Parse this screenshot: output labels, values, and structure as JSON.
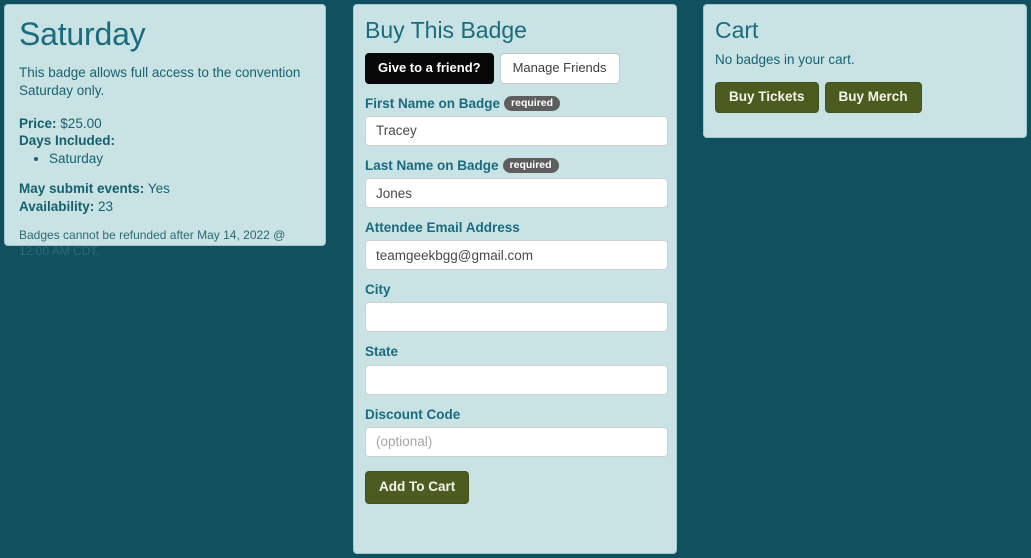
{
  "theme": {
    "page_background": "#11505f",
    "card_background": "#c9e3e5",
    "heading_color": "#1a6b7d",
    "accent_olive": "#4c5c21",
    "required_pill": "#5e5e5e"
  },
  "badge_card": {
    "title": "Saturday",
    "description": "This badge allows full access to the convention Saturday only.",
    "price_label": "Price:",
    "price_value": "$25.00",
    "days_label": "Days Included:",
    "days": [
      "Saturday"
    ],
    "may_submit_label": "May submit events:",
    "may_submit_value": "Yes",
    "availability_label": "Availability:",
    "availability_value": "23",
    "refund_notice": "Badges cannot be refunded after May 14, 2022 @ 12:00 AM CDT."
  },
  "buy_panel": {
    "title": "Buy This Badge",
    "give_to_friend_label": "Give to a friend?",
    "manage_friends_label": "Manage Friends",
    "required_badge_text": "required",
    "fields": {
      "first_name": {
        "label": "First Name on Badge",
        "value": "Tracey",
        "placeholder": ""
      },
      "last_name": {
        "label": "Last Name on Badge",
        "value": "Jones",
        "placeholder": ""
      },
      "email": {
        "label": "Attendee Email Address",
        "value": "teamgeekbgg@gmail.com",
        "placeholder": ""
      },
      "city": {
        "label": "City",
        "value": "",
        "placeholder": ""
      },
      "state": {
        "label": "State",
        "value": "",
        "placeholder": ""
      },
      "discount_code": {
        "label": "Discount Code",
        "value": "",
        "placeholder": "(optional)"
      }
    },
    "add_to_cart_label": "Add To Cart"
  },
  "cart_panel": {
    "title": "Cart",
    "empty_message": "No badges in your cart.",
    "buy_tickets_label": "Buy Tickets",
    "buy_merch_label": "Buy Merch"
  }
}
